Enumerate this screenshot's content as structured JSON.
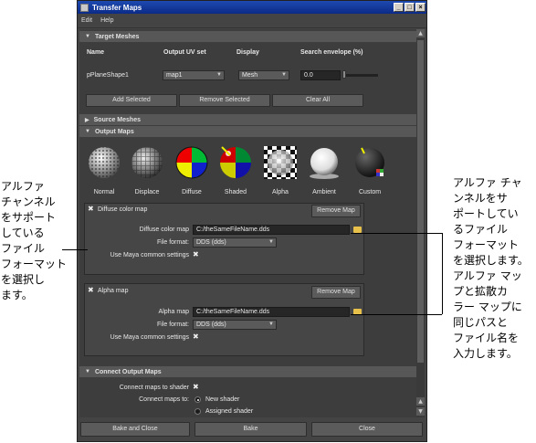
{
  "window": {
    "title": "Transfer Maps"
  },
  "menu": [
    "Edit",
    "Help"
  ],
  "target_meshes": {
    "section_title": "Target Meshes",
    "headers": {
      "name": "Name",
      "uv_set": "Output UV set",
      "display": "Display",
      "envelope": "Search envelope (%)"
    },
    "row": {
      "name": "pPlaneShape1",
      "uv_set": "map1",
      "display": "Mesh",
      "envelope": "0.0"
    },
    "buttons": {
      "add": "Add Selected",
      "remove": "Remove Selected",
      "clear": "Clear All"
    }
  },
  "source_meshes": {
    "section_title": "Source Meshes"
  },
  "output_maps": {
    "section_title": "Output Maps",
    "types": [
      "Normal",
      "Displace",
      "Diffuse",
      "Shaded",
      "Alpha",
      "Ambient",
      "Custom"
    ],
    "diffuse": {
      "title": "Diffuse color map",
      "remove": "Remove Map",
      "map_label": "Diffuse color map",
      "map_value": "C:/theSameFileName.dds",
      "format_label": "File format:",
      "format_value": "DDS (dds)",
      "common_label": "Use Maya common settings"
    },
    "alpha": {
      "title": "Alpha map",
      "remove": "Remove Map",
      "map_label": "Alpha map",
      "map_value": "C:/theSameFileName.dds",
      "format_label": "File format:",
      "format_value": "DDS (dds)",
      "common_label": "Use Maya common settings"
    }
  },
  "connect_output": {
    "section_title": "Connect Output Maps",
    "connect_label": "Connect maps to shader",
    "to_label": "Connect maps to:",
    "new_shader": "New shader",
    "assigned_shader": "Assigned shader"
  },
  "bottom_buttons": {
    "bake_close": "Bake and Close",
    "bake": "Bake",
    "close": "Close"
  },
  "callouts": {
    "left": [
      "アルファ",
      "チャンネル",
      "をサポート",
      "している",
      "ファイル",
      "フォーマット",
      "を選択し",
      "ます。"
    ],
    "right": [
      "アルファ チャ",
      "ンネルをサ",
      "ポートしてい",
      "るファイル",
      "フォーマット",
      "を選択します。",
      "アルファ マッ",
      "プと拡散カ",
      "ラー マップに",
      "同じパスと",
      "ファイル名を",
      "入力します。"
    ]
  },
  "colors": {
    "title_bar": "#0b2a86",
    "panel": "#3d3d3d",
    "folder": "#e8c14b"
  }
}
